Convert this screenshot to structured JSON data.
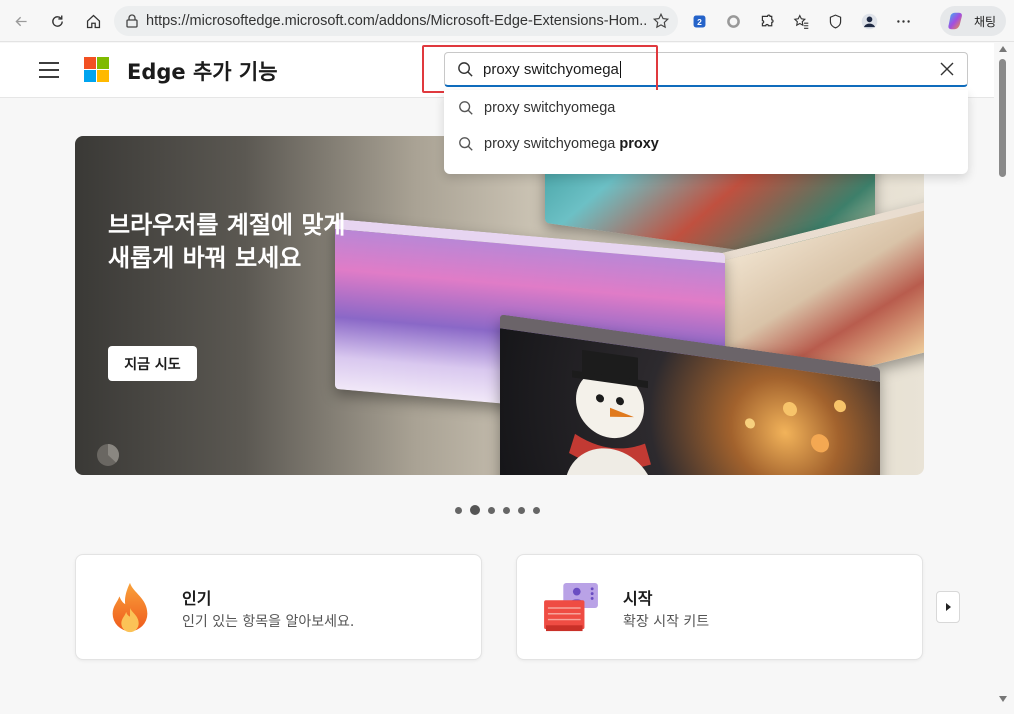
{
  "browser": {
    "url": "https://microsoftedge.microsoft.com/addons/Microsoft-Edge-Extensions-Hom...",
    "chat_label": "채팅",
    "extensions_badge": "2",
    "icons": [
      "back-icon",
      "refresh-icon",
      "home-icon",
      "lock-icon",
      "favorite-star-icon",
      "extension-badge-icon",
      "circle-icon",
      "extensions-puzzle-icon",
      "favorites-icon",
      "shield-icon",
      "profile-avatar-icon",
      "more-icon",
      "copilot-icon"
    ]
  },
  "header": {
    "title": "Edge 추가 기능",
    "logo_colors": [
      "#f25022",
      "#7fba00",
      "#00a4ef",
      "#ffb900"
    ]
  },
  "search": {
    "value": "proxy switchyomega",
    "suggestions": [
      {
        "text": "proxy switchyomega",
        "bold": ""
      },
      {
        "text": "proxy switchyomega",
        "bold": "proxy"
      }
    ]
  },
  "hero": {
    "title": "브라우저를 계절에 맞게 새롭게 바꿔 보세요",
    "button": "지금 시도",
    "slides_total": 6,
    "active_slide": 2
  },
  "cards": [
    {
      "title": "인기",
      "subtitle": "인기 있는 항목을 알아보세요.",
      "icon": "flame-icon"
    },
    {
      "title": "시작",
      "subtitle": "확장 시작 키트",
      "icon": "starter-kit-icon"
    }
  ],
  "colors": {
    "accent": "#0f6cbd",
    "highlight": "#e0393e"
  }
}
